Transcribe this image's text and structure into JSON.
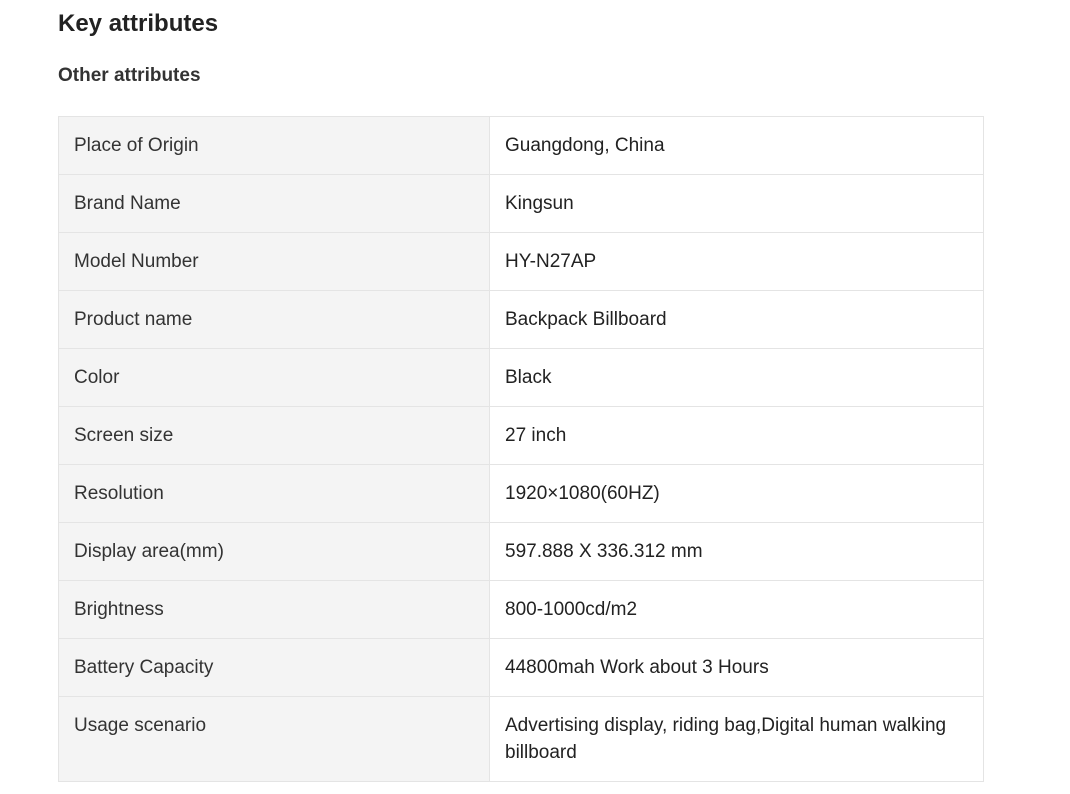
{
  "header": {
    "title": "Key attributes",
    "subtitle": "Other attributes"
  },
  "attributes": [
    {
      "key": "Place of Origin",
      "value": "Guangdong, China"
    },
    {
      "key": "Brand Name",
      "value": "Kingsun"
    },
    {
      "key": "Model Number",
      "value": "HY-N27AP"
    },
    {
      "key": "Product name",
      "value": "Backpack Billboard"
    },
    {
      "key": "Color",
      "value": "Black"
    },
    {
      "key": "Screen size",
      "value": "27 inch"
    },
    {
      "key": "Resolution",
      "value": "1920×1080(60HZ)"
    },
    {
      "key": "Display area(mm)",
      "value": "597.888 X 336.312 mm"
    },
    {
      "key": "Brightness",
      "value": "800-1000cd/m2"
    },
    {
      "key": "Battery Capacity",
      "value": "44800mah Work about 3 Hours"
    },
    {
      "key": "Usage scenario",
      "value": "Advertising display, riding bag,Digital human walking billboard"
    }
  ],
  "colors": {
    "key_cell_bg": "#f4f4f4",
    "border": "#e4e4e4",
    "text": "#222222"
  }
}
